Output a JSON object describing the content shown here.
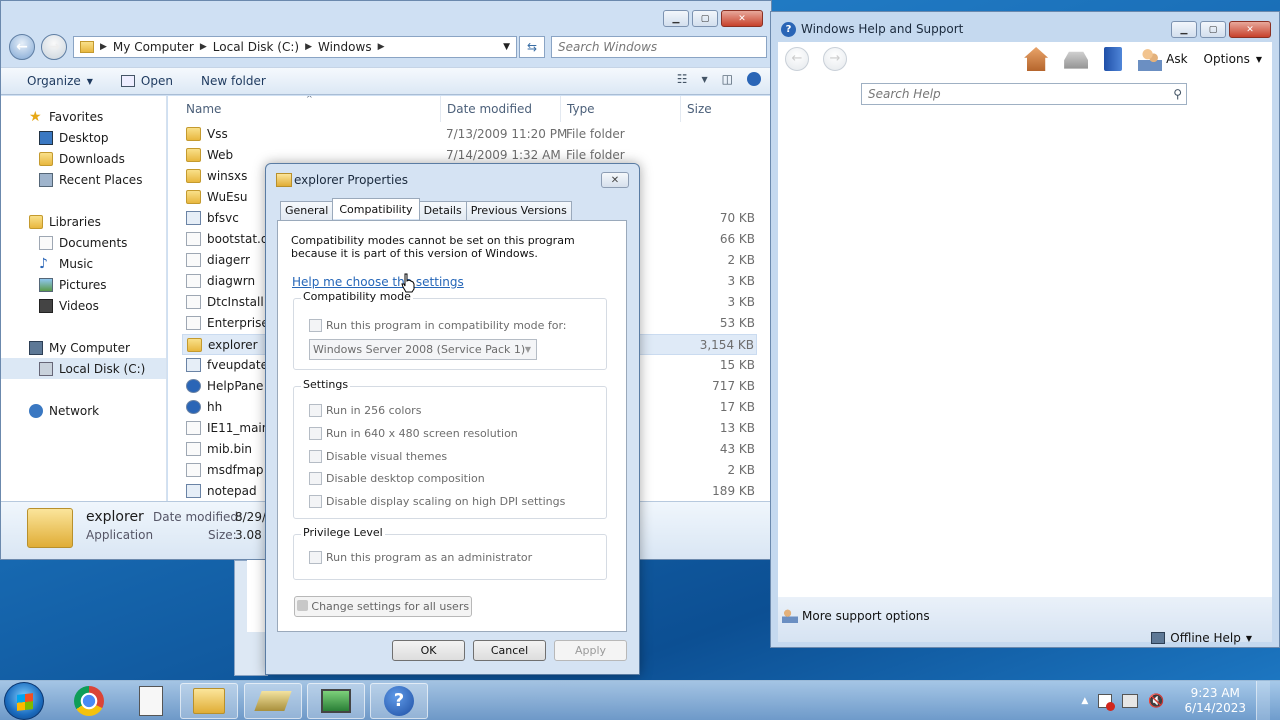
{
  "explorer": {
    "breadcrumb": [
      "My Computer",
      "Local Disk (C:)",
      "Windows"
    ],
    "search_placeholder": "Search Windows",
    "toolbar": {
      "organize": "Organize",
      "open": "Open",
      "new_folder": "New folder"
    },
    "nav": {
      "favorites": "Favorites",
      "desktop": "Desktop",
      "downloads": "Downloads",
      "recent": "Recent Places",
      "libraries": "Libraries",
      "documents": "Documents",
      "music": "Music",
      "pictures": "Pictures",
      "videos": "Videos",
      "computer": "My Computer",
      "local_disk": "Local Disk (C:)",
      "network": "Network"
    },
    "columns": {
      "name": "Name",
      "date": "Date modified",
      "type": "Type",
      "size": "Size"
    },
    "files": [
      {
        "name": "Vss",
        "date": "7/13/2009 11:20 PM",
        "type": "File folder",
        "size": "",
        "icon": "folder"
      },
      {
        "name": "Web",
        "date": "7/14/2009 1:32 AM",
        "type": "File folder",
        "size": "",
        "icon": "folder"
      },
      {
        "name": "winsxs",
        "date": "",
        "type": "",
        "size": "",
        "icon": "folder"
      },
      {
        "name": "WuEsu",
        "date": "",
        "type": "",
        "size": "",
        "icon": "folder"
      },
      {
        "name": "bfsvc",
        "date": "",
        "type": "",
        "size": "70 KB",
        "icon": "exe"
      },
      {
        "name": "bootstat.da",
        "date": "",
        "type": "",
        "size": "66 KB",
        "icon": "file"
      },
      {
        "name": "diagerr",
        "date": "",
        "type": "nt",
        "size": "2 KB",
        "icon": "file"
      },
      {
        "name": "diagwrn",
        "date": "",
        "type": "nt",
        "size": "3 KB",
        "icon": "file"
      },
      {
        "name": "DtcInstall",
        "date": "",
        "type": "nt",
        "size": "3 KB",
        "icon": "file"
      },
      {
        "name": "Enterprise",
        "date": "",
        "type": "nt",
        "size": "53 KB",
        "icon": "file"
      },
      {
        "name": "explorer",
        "date": "",
        "type": "",
        "size": "3,154 KB",
        "icon": "folder"
      },
      {
        "name": "fveupdate",
        "date": "",
        "type": "",
        "size": "15 KB",
        "icon": "exe"
      },
      {
        "name": "HelpPane",
        "date": "",
        "type": "",
        "size": "717 KB",
        "icon": "help"
      },
      {
        "name": "hh",
        "date": "",
        "type": "",
        "size": "17 KB",
        "icon": "help"
      },
      {
        "name": "IE11_main",
        "date": "",
        "type": "nt",
        "size": "13 KB",
        "icon": "file"
      },
      {
        "name": "mib.bin",
        "date": "",
        "type": "",
        "size": "43 KB",
        "icon": "file"
      },
      {
        "name": "msdfmap",
        "date": "",
        "type": "sett...",
        "size": "2 KB",
        "icon": "file"
      },
      {
        "name": "notepad",
        "date": "",
        "type": "",
        "size": "189 KB",
        "icon": "exe"
      }
    ],
    "details": {
      "name": "explorer",
      "type": "Application",
      "date_label": "Date modified:",
      "date_value": "8/29/",
      "size_label": "Size:",
      "size_value": "3.08 M"
    }
  },
  "dialog": {
    "title": "explorer Properties",
    "tabs": [
      "General",
      "Compatibility",
      "Details",
      "Previous Versions"
    ],
    "info": "Compatibility modes cannot be set on this program because it is part of this version of Windows.",
    "help_link": "Help me choose the settings",
    "compat_group": "Compatibility mode",
    "compat_checkbox": "Run this program in compatibility mode for:",
    "compat_select": "Windows Server 2008 (Service Pack 1)",
    "settings_group": "Settings",
    "settings": [
      "Run in 256 colors",
      "Run in 640 x 480 screen resolution",
      "Disable visual themes",
      "Disable desktop composition",
      "Disable display scaling on high DPI settings"
    ],
    "privilege_group": "Privilege Level",
    "privilege_checkbox": "Run this program as an administrator",
    "change_all": "Change settings for all users",
    "ok": "OK",
    "cancel": "Cancel",
    "apply": "Apply"
  },
  "help": {
    "title": "Windows Help and Support",
    "ask": "Ask",
    "options": "Options",
    "search_placeholder": "Search Help",
    "more_support": "More support options",
    "offline": "Offline Help"
  },
  "taskbar": {
    "time": "9:23 AM",
    "date": "6/14/2023"
  }
}
